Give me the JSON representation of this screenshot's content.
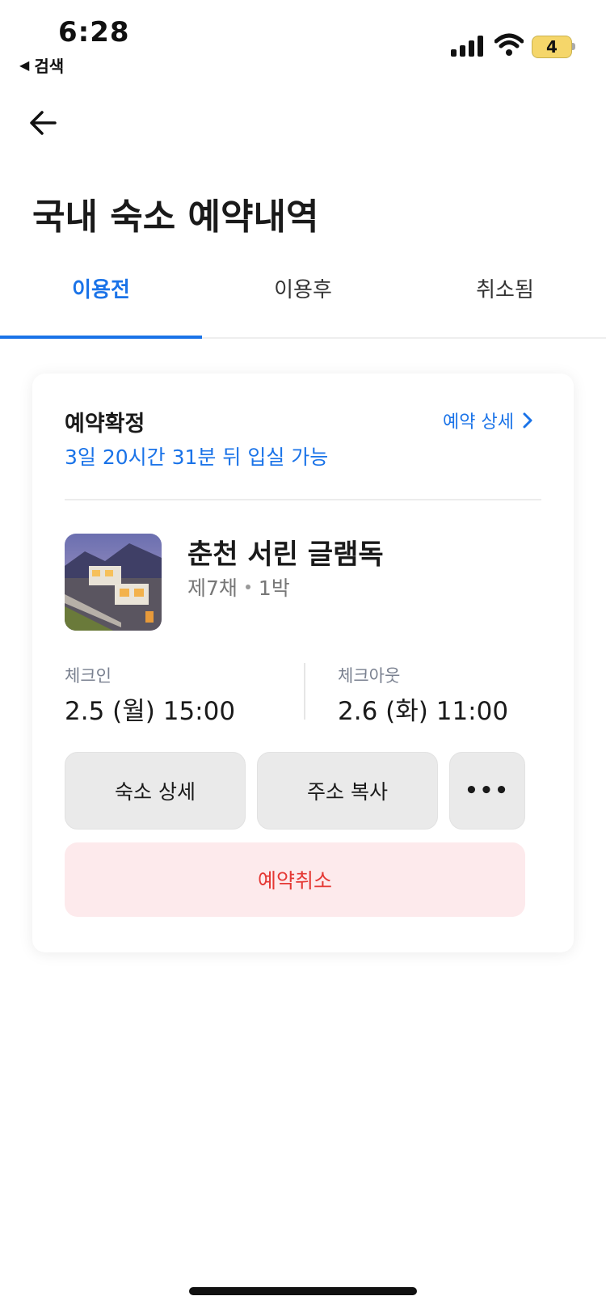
{
  "status_bar": {
    "time": "6:28",
    "back_app": "검색",
    "battery_level": "4",
    "battery_color": "#f5d66a"
  },
  "header": {
    "back_icon": "arrow-left-icon",
    "title": "국내 숙소 예약내역"
  },
  "tabs": [
    {
      "label": "이용전",
      "active": true
    },
    {
      "label": "이용후",
      "active": false
    },
    {
      "label": "취소됨",
      "active": false
    }
  ],
  "accent_color": "#1a73e8",
  "reservation": {
    "status": "예약확정",
    "status_sub": "3일 20시간 31분 뒤 입실 가능",
    "detail_link": "예약 상세",
    "property_name": "춘천 서린 글램독",
    "room": "제7채",
    "nights": "1박",
    "checkin_label": "체크인",
    "checkin_value": "2.5 (월) 15:00",
    "checkout_label": "체크아웃",
    "checkout_value": "2.6 (화) 11:00",
    "buttons": {
      "property_detail": "숙소 상세",
      "copy_address": "주소 복사",
      "more": "•••"
    },
    "cancel_label": "예약취소",
    "cancel_color": "#e53935"
  }
}
